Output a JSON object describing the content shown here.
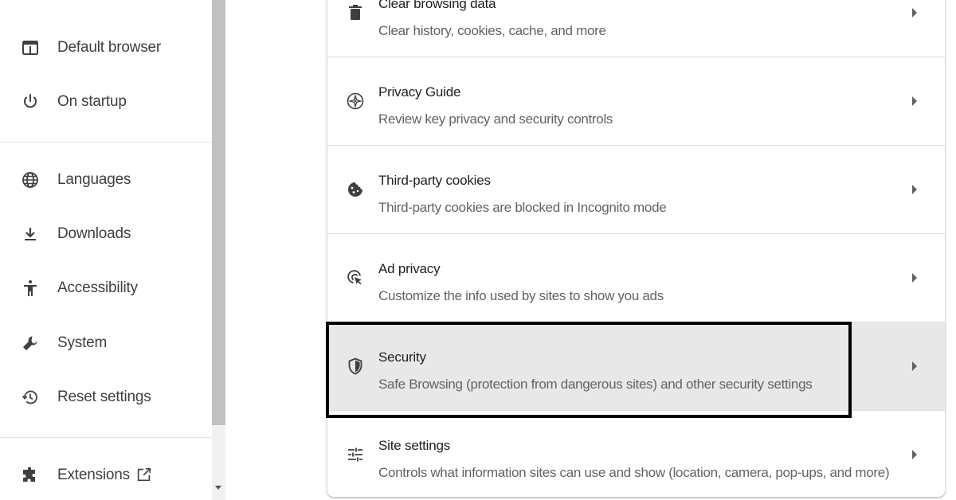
{
  "sidebar": {
    "items": [
      {
        "label": "Default browser",
        "icon": "browser-window-icon"
      },
      {
        "label": "On startup",
        "icon": "power-icon"
      },
      {
        "label": "Languages",
        "icon": "globe-icon"
      },
      {
        "label": "Downloads",
        "icon": "download-icon"
      },
      {
        "label": "Accessibility",
        "icon": "accessibility-icon"
      },
      {
        "label": "System",
        "icon": "wrench-icon"
      },
      {
        "label": "Reset settings",
        "icon": "reset-history-icon"
      },
      {
        "label": "Extensions",
        "icon": "puzzle-icon"
      }
    ]
  },
  "privacy": {
    "rows": [
      {
        "title": "Clear browsing data",
        "subtitle": "Clear history, cookies, cache, and more",
        "icon": "trash-icon"
      },
      {
        "title": "Privacy Guide",
        "subtitle": "Review key privacy and security controls",
        "icon": "compass-icon"
      },
      {
        "title": "Third-party cookies",
        "subtitle": "Third-party cookies are blocked in Incognito mode",
        "icon": "cookie-icon"
      },
      {
        "title": "Ad privacy",
        "subtitle": "Customize the info used by sites to show you ads",
        "icon": "ad-privacy-icon"
      },
      {
        "title": "Security",
        "subtitle": "Safe Browsing (protection from dangerous sites) and other security settings",
        "icon": "shield-icon"
      },
      {
        "title": "Site settings",
        "subtitle": "Controls what information sites can use and show (location, camera, pop-ups, and more)",
        "icon": "tune-icon"
      }
    ]
  },
  "colors": {
    "highlight_row": "#e8e8e8",
    "annotation_border": "#000000"
  }
}
